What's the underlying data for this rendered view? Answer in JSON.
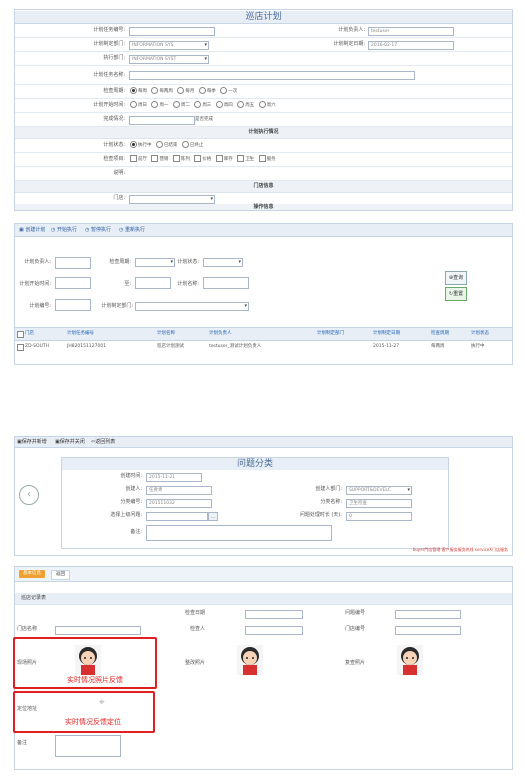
{
  "panel1": {
    "title": "巡店计划",
    "fields": {
      "plan_no_label": "计划任务编号:",
      "responsible_label": "计划负责人:",
      "responsible_value": "testuser",
      "dept_label": "计划制定部门:",
      "dept_value": "INFORMATION SYS",
      "date_label": "计划制定日期:",
      "date_value": "2016-02-17",
      "exec_dept_label": "执行部门:",
      "exec_dept_value": "INFORMATION SYST",
      "name_label": "计划任务名称:",
      "cycle_label": "检查周期:",
      "cycle_options": [
        "每周",
        "每两周",
        "每月",
        "每季",
        "一次"
      ],
      "weekday_label": "计划开始时间:",
      "weekdays": [
        "周日",
        "周一",
        "周二",
        "周三",
        "周四",
        "周五",
        "周六"
      ],
      "done_label": "完成情况:",
      "done_note": "是否完成",
      "section_exec": "计划执行情况",
      "status_label": "计划状态:",
      "status_options": [
        "执行中",
        "已结束",
        "已终止"
      ],
      "check_label": "检查项目:",
      "check_options": [
        "前厅",
        "营销",
        "陈列",
        "价格",
        "库存",
        "卫生",
        "服务"
      ],
      "remark_label": "说明:",
      "section_store": "门店信息",
      "store_label": "门店:",
      "section_footer": "操作信息"
    }
  },
  "panel2": {
    "toolbar": [
      "创建计划",
      "开始执行",
      "暂停执行",
      "重新执行"
    ],
    "filters": {
      "responsible": "计划负责人:",
      "cycle": "检查周期:",
      "status": "计划状态:",
      "start": "计划开始时间:",
      "to": "至:",
      "name": "计划名称:",
      "plan_no": "计划编号:",
      "dept": "计划制定部门:"
    },
    "search_label": "查询",
    "reset_label": "重置",
    "columns": [
      "门店",
      "计划任务编号",
      "计划名称",
      "计划负责人",
      "计划制定部门",
      "计划制定日期",
      "检查周期",
      "计划状态"
    ],
    "rows": [
      [
        "ZD-SOUTH",
        "JH820151127001",
        "巡店计划测试",
        "testuser_测试计划负责人",
        "",
        "2015-11-27",
        "每两周",
        "执行中"
      ]
    ]
  },
  "panel3": {
    "toolbar": [
      "保存并新增",
      "保存并关闭",
      "返回列表"
    ],
    "title": "问题分类",
    "create_time_label": "创建时间:",
    "create_time_value": "2015-11-21",
    "creator_label": "创建人:",
    "creator_value": "任青青",
    "creator_dept_label": "创建人部门:",
    "creator_dept_value": "SUPPORT&DEVELC",
    "class_no_label": "分类编号:",
    "class_no_value": "201511032",
    "class_name_label": "分类名称:",
    "class_name_value": "卫生检查",
    "parent_label": "选择上级问题:",
    "days_label": "问题处理时长 (天):",
    "days_value": "0",
    "remark_label": "备注:",
    "footer_text": "buyer門店管理  客户服务服务热线  serviceX门店服务"
  },
  "panel4": {
    "tabs": [
      "基本信息",
      "返回"
    ],
    "section": "巡店记录表",
    "labels": {
      "a1": "门店编号",
      "a2": "检查日期",
      "b1": "门店名称",
      "b2": "检查人",
      "b3": "问题编号",
      "p1": "现场照片",
      "p2": "整改照片",
      "p3": "复查照片",
      "loc": "定位地址",
      "remark": "备注"
    },
    "annot_photo": "实时情况照片反馈",
    "annot_loc": "实时情况反馈定位"
  }
}
